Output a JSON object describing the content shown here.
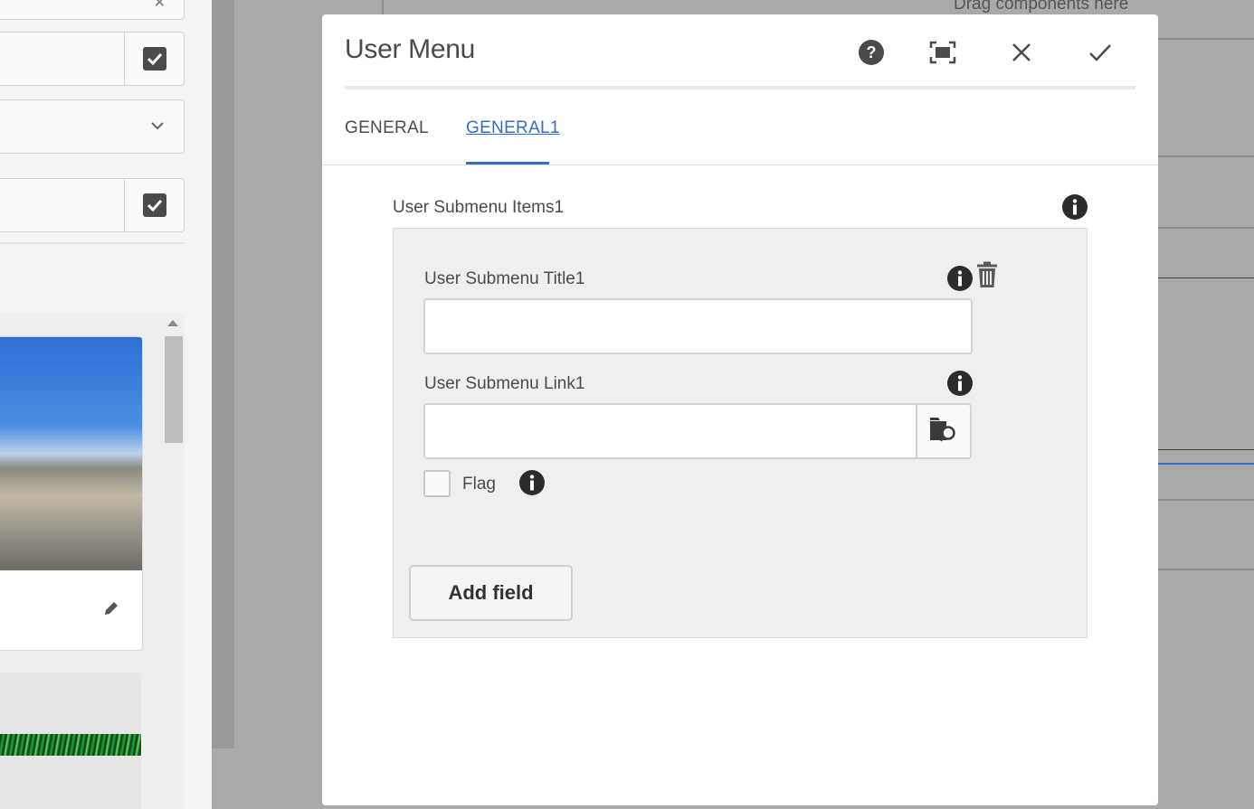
{
  "canvas": {
    "drop_hint": "Drag components here"
  },
  "dialog": {
    "title": "User Menu",
    "actions": {
      "help_icon": "help-icon",
      "fullscreen_icon": "fullscreen-icon",
      "cancel_icon": "close-icon",
      "done_icon": "checkmark-icon"
    },
    "tabs": [
      {
        "label": "GENERAL",
        "active": false
      },
      {
        "label": "GENERAL1",
        "active": true
      }
    ],
    "multifield": {
      "label": "User Submenu Items1",
      "item": {
        "title_label": "User Submenu Title1",
        "title_value": "",
        "link_label": "User Submenu Link1",
        "link_value": "",
        "flag_label": "Flag",
        "flag_checked": false
      },
      "add_button": "Add field"
    }
  },
  "colors": {
    "accent": "#326ec8",
    "text": "#4b4b4b",
    "overlay": "#a9a9a9"
  }
}
